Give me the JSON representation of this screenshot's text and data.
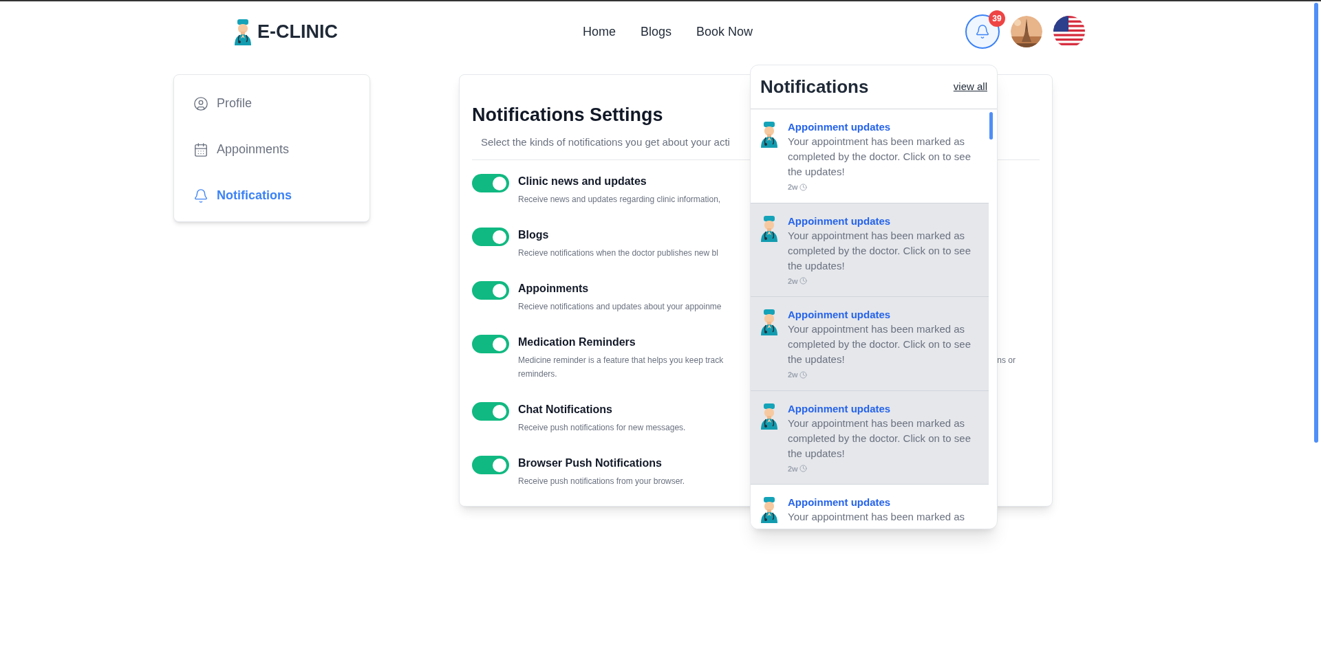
{
  "brand": {
    "name": "E-CLINIC"
  },
  "nav": [
    {
      "label": "Home"
    },
    {
      "label": "Blogs"
    },
    {
      "label": "Book Now"
    }
  ],
  "notification_badge": "39",
  "sidebar": {
    "items": [
      {
        "label": "Profile",
        "kind": "profile",
        "selected": false
      },
      {
        "label": "Appoinments",
        "kind": "calendar",
        "selected": false
      },
      {
        "label": "Notifications",
        "kind": "bell",
        "selected": true
      }
    ]
  },
  "settings": {
    "title": "Notifications Settings",
    "subtitle": "Select the kinds of notifications you get about your acti",
    "items": [
      {
        "label": "Clinic news and updates",
        "description": "Receive news and updates regarding clinic information,",
        "on": true
      },
      {
        "label": "Blogs",
        "description": "Recieve notifications when the doctor publishes new bl",
        "on": true
      },
      {
        "label": "Appoinments",
        "description": "Recieve notifications and updates about your appoinme",
        "on": true
      },
      {
        "label": "Medication Reminders",
        "description": "Medicine reminder is a feature that helps you keep track",
        "description_tail": "ns or",
        "description_line_2": "reminders.",
        "on": true
      },
      {
        "label": "Chat Notifications",
        "description": "Receive push notifications for new messages.",
        "on": true
      },
      {
        "label": "Browser Push Notifications",
        "description": "Receive push notifications from your browser.",
        "on": true
      }
    ]
  },
  "notifications": {
    "title": "Notifications",
    "view_all": "view all",
    "items": [
      {
        "title": "Appoinment updates",
        "message": "Your appointment has been marked as completed by the doctor. Click on to see the updates!",
        "time": "2w",
        "unread": false
      },
      {
        "title": "Appoinment updates",
        "message": "Your appointment has been marked as completed by the doctor. Click on to see the updates!",
        "time": "2w",
        "unread": true
      },
      {
        "title": "Appoinment updates",
        "message": "Your appointment has been marked as completed by the doctor. Click on to see the updates!",
        "time": "2w",
        "unread": true
      },
      {
        "title": "Appoinment updates",
        "message": "Your appointment has been marked as completed by the doctor. Click on to see the updates!",
        "time": "2w",
        "unread": true
      },
      {
        "title": "Appoinment updates",
        "message": "Your appointment has been marked as",
        "unread": false
      }
    ]
  }
}
